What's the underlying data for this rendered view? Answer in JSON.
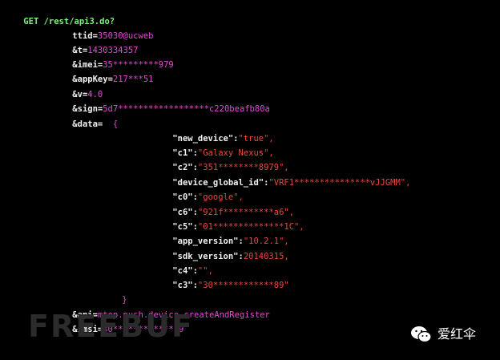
{
  "request": {
    "method": "GET",
    "path": " /rest/api3.do?"
  },
  "params": [
    {
      "key": "ttid",
      "value": "35030@ucweb"
    },
    {
      "key": "&t",
      "value": "1430334357"
    },
    {
      "key": "&imei",
      "value": "35*********979"
    },
    {
      "key": "&appKey",
      "value": "217***51"
    },
    {
      "key": "&v",
      "value": "4.0"
    },
    {
      "key": "&sign",
      "value": "5d7******************c220beafb80a"
    }
  ],
  "data": {
    "key": "&data=",
    "open": "{",
    "close": "}",
    "entries": [
      {
        "key": "\"new_device\"",
        "value": "\"true\","
      },
      {
        "key": "\"c1\"",
        "value": "\"Galaxy Nexus\","
      },
      {
        "key": "\"c2\"",
        "value": "\"351********8979\","
      },
      {
        "key": "\"device_global_id\"",
        "value": "\"VRF1***************vJJGMM\","
      },
      {
        "key": "\"c0\"",
        "value": "\"google\","
      },
      {
        "key": "\"c6\"",
        "value": "\"921f**********a6\","
      },
      {
        "key": "\"c5\"",
        "value": "\"01**************1C\","
      },
      {
        "key": "\"app_version\"",
        "value": "\"10.2.1\","
      },
      {
        "key": "\"sdk_version\"",
        "value": "20140315,"
      },
      {
        "key": "\"c4\"",
        "value": "\"\","
      },
      {
        "key": "\"c3\"",
        "value": "\"30************89\""
      }
    ]
  },
  "after": [
    {
      "key": "&api",
      "value": "mtop.push.device.createAndRegister"
    },
    {
      "key": "&imsi",
      "value": "30************89"
    }
  ],
  "watermark": "FREEBUF",
  "brand": {
    "name": "爱红伞",
    "icon": "wechat-icon"
  }
}
